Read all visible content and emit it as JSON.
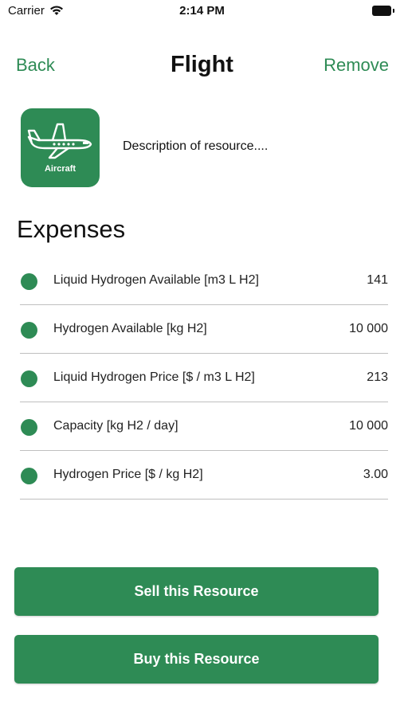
{
  "status_bar": {
    "carrier": "Carrier",
    "time": "2:14 PM",
    "wifi_icon": "wifi-icon",
    "battery_icon": "battery-icon"
  },
  "nav": {
    "back_label": "Back",
    "title": "Flight",
    "remove_label": "Remove"
  },
  "resource": {
    "icon": "aircraft-icon",
    "icon_label": "Aircraft",
    "description": "Description of resource...."
  },
  "expenses": {
    "title": "Expenses",
    "items": [
      {
        "label": "Liquid Hydrogen Available [m3 L H2]",
        "value": "141"
      },
      {
        "label": "Hydrogen Available [kg H2]",
        "value": "10 000"
      },
      {
        "label": "Liquid Hydrogen Price [$ / m3 L H2]",
        "value": "213"
      },
      {
        "label": "Capacity [kg H2 / day]",
        "value": "10 000"
      },
      {
        "label": "Hydrogen Price [$ / kg H2]",
        "value": "3.00"
      }
    ]
  },
  "actions": {
    "sell_label": "Sell this Resource",
    "buy_label": "Buy this Resource"
  },
  "colors": {
    "accent": "#2e8b55",
    "divider": "#bfbfbf"
  }
}
